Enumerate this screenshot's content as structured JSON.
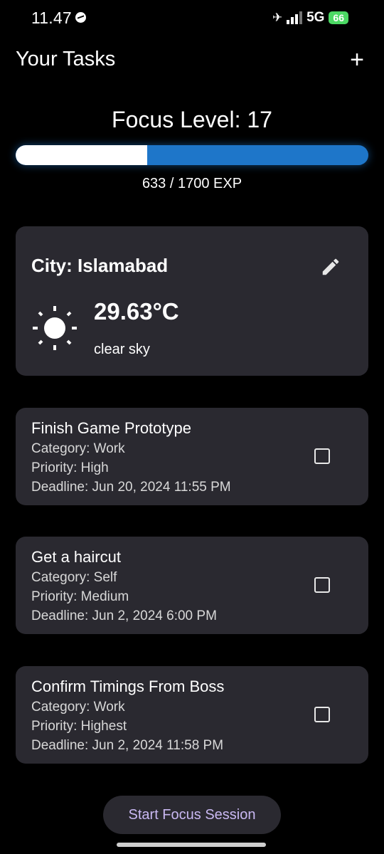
{
  "status_bar": {
    "time": "11.47",
    "network": "5G",
    "battery": "66",
    "icons": [
      "messenger-icon",
      "no-signal-icon",
      "signal-icon"
    ]
  },
  "header": {
    "title": "Your Tasks",
    "add_label": "+"
  },
  "focus": {
    "level_text": "Focus Level: 17",
    "exp_text": "633 / 1700 EXP",
    "exp_current": 633,
    "exp_max": 1700
  },
  "weather": {
    "city_text": "City: Islamabad",
    "temperature": "29.63°C",
    "description": "clear sky",
    "icon": "sun-icon"
  },
  "tasks": [
    {
      "title": "Finish Game Prototype",
      "category": "Category: Work",
      "priority": "Priority: High",
      "deadline": "Deadline: Jun 20, 2024 11:55 PM",
      "checked": false
    },
    {
      "title": "Get a haircut",
      "category": "Category: Self",
      "priority": "Priority: Medium",
      "deadline": "Deadline: Jun 2, 2024 6:00 PM",
      "checked": false
    },
    {
      "title": "Confirm Timings From Boss",
      "category": "Category: Work",
      "priority": "Priority: Highest",
      "deadline": "Deadline: Jun 2, 2024 11:58 PM",
      "checked": false
    }
  ],
  "footer": {
    "focus_button_label": "Start Focus Session"
  },
  "colors": {
    "background": "#000000",
    "card": "#2a2930",
    "progress": "#1e76c9",
    "button_text": "#c9b8f2",
    "battery": "#4cd964"
  }
}
